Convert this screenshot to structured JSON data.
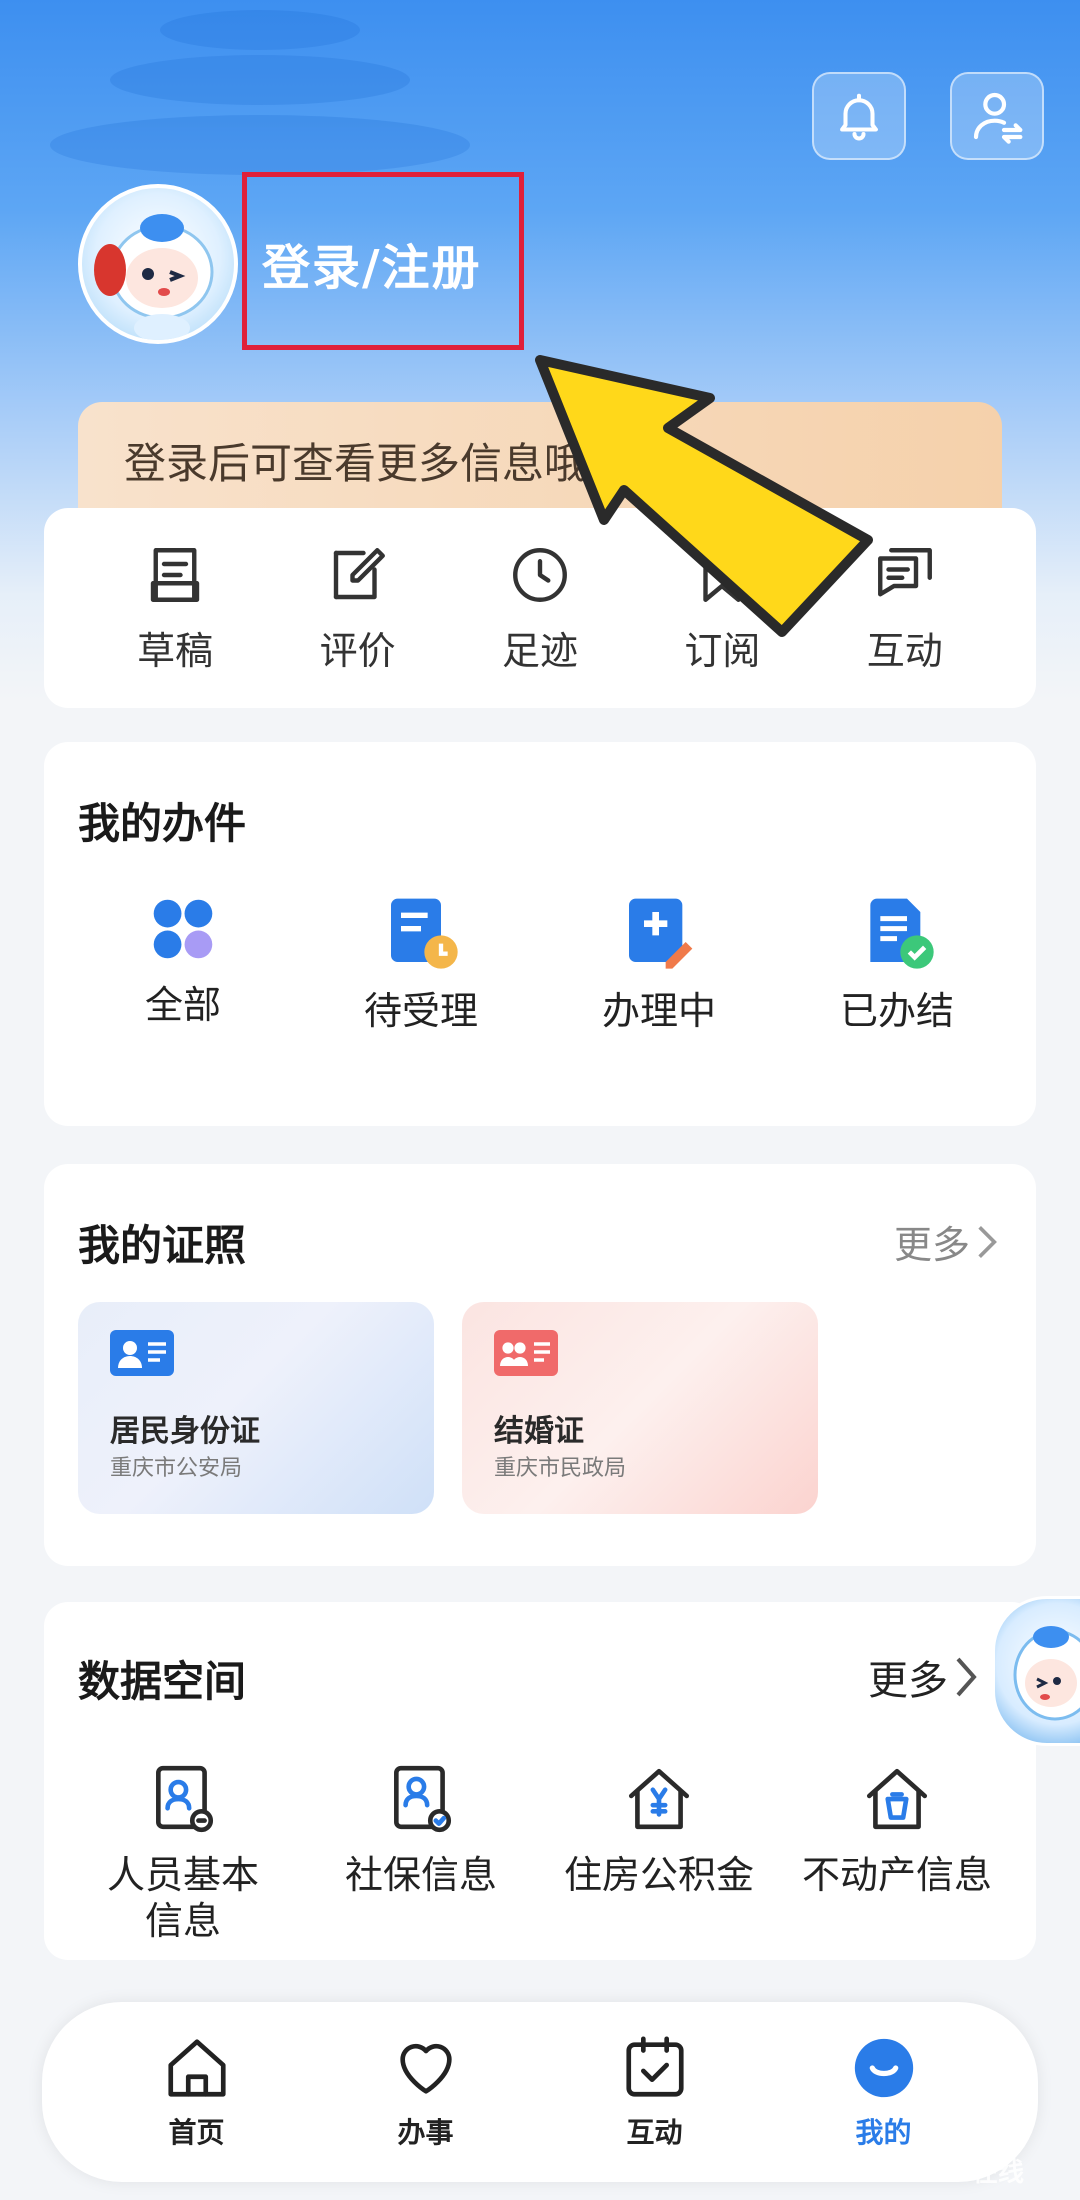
{
  "header": {
    "login_label": "登录/注册",
    "promo_text": "登录后可查看更多信息哦"
  },
  "quick_actions": [
    {
      "label": "草稿",
      "icon": "draft-icon"
    },
    {
      "label": "评价",
      "icon": "edit-icon"
    },
    {
      "label": "足迹",
      "icon": "clock-icon"
    },
    {
      "label": "订阅",
      "icon": "bookmark-icon"
    },
    {
      "label": "互动",
      "icon": "chat-icon"
    }
  ],
  "my_cases": {
    "title": "我的办件",
    "items": [
      {
        "label": "全部",
        "icon": "grid-icon"
      },
      {
        "label": "待受理",
        "icon": "pending-doc-icon"
      },
      {
        "label": "办理中",
        "icon": "processing-doc-icon"
      },
      {
        "label": "已办结",
        "icon": "done-doc-icon"
      }
    ]
  },
  "my_licenses": {
    "title": "我的证照",
    "more": "更多",
    "items": [
      {
        "name": "居民身份证",
        "org": "重庆市公安局",
        "color": "#2a7ce8"
      },
      {
        "name": "结婚证",
        "org": "重庆市民政局",
        "color": "#f06a6a"
      }
    ]
  },
  "data_space": {
    "title": "数据空间",
    "more": "更多",
    "items": [
      {
        "label_line1": "人员基本",
        "label_line2": "信息",
        "icon": "person-info-icon"
      },
      {
        "label_line1": "社保信息",
        "label_line2": "",
        "icon": "social-security-icon"
      },
      {
        "label_line1": "住房公积金",
        "label_line2": "",
        "icon": "housing-fund-icon"
      },
      {
        "label_line1": "不动产信息",
        "label_line2": "",
        "icon": "real-estate-icon"
      }
    ]
  },
  "tabbar": [
    {
      "label": "首页",
      "icon": "home-icon"
    },
    {
      "label": "办事",
      "icon": "heart-icon"
    },
    {
      "label": "互动",
      "icon": "calendar-check-icon"
    },
    {
      "label": "我的",
      "icon": "smile-icon",
      "active": true
    }
  ],
  "colors": {
    "accent": "#2a7ce8",
    "highlight_box": "#e0203a",
    "arrow": "#ffd81a"
  },
  "watermark": "在线"
}
